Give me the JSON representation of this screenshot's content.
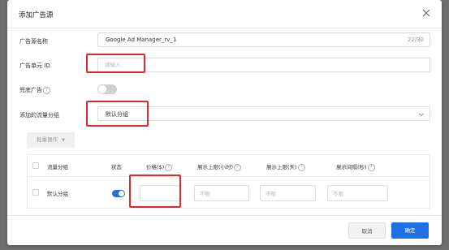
{
  "dialog": {
    "title": "添加广告源"
  },
  "form": {
    "source_name": {
      "label": "广告源名称",
      "value": "Google Ad Manager_rv_1",
      "count": "22/30"
    },
    "unit_id": {
      "label": "广告单元 ID",
      "placeholder": "请输入"
    },
    "fallback_ad": {
      "label": "兜底广告",
      "enabled": false
    },
    "traffic_group": {
      "label": "添加的流量分组",
      "value": "默认分组"
    }
  },
  "batch": {
    "label": "批量操作"
  },
  "table": {
    "headers": [
      "流量分组",
      "状态",
      "价格($)",
      "展示上限(小时)",
      "展示上限(天)",
      "展示间隔(秒)"
    ],
    "rows": [
      {
        "group": "默认分组",
        "status": true,
        "price": "",
        "hour_cap_placeholder": "不限",
        "day_cap_placeholder": "不限",
        "interval_placeholder": "不限"
      }
    ]
  },
  "footer": {
    "cancel_label": "取消",
    "ok_label": "确定"
  },
  "colors": {
    "primary": "#1f6fe5",
    "highlight": "#e3262e"
  }
}
